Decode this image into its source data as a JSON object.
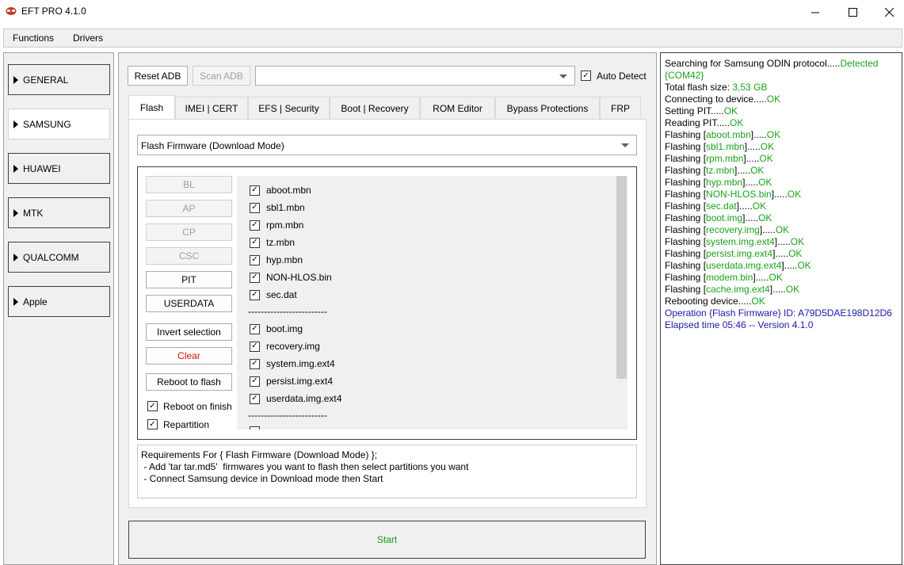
{
  "window": {
    "title": "EFT PRO 4.1.0",
    "controls": {
      "minimize": "—",
      "maximize": "☐",
      "close": "✕"
    }
  },
  "menu": {
    "items": [
      "Functions",
      "Drivers"
    ]
  },
  "categories": [
    {
      "label": "GENERAL",
      "active": false,
      "arrow": true
    },
    {
      "label": "SAMSUNG",
      "active": true,
      "arrow": true
    },
    {
      "label": "HUAWEI",
      "active": false,
      "arrow": true
    },
    {
      "label": "MTK",
      "active": false,
      "arrow": true
    },
    {
      "label": "QUALCOMM",
      "active": false,
      "arrow": true
    },
    {
      "label": "Apple",
      "active": false,
      "arrow": true
    }
  ],
  "toolbar": {
    "reset_adb": "Reset ADB",
    "scan_adb": "Scan ADB",
    "device_combo_value": "",
    "auto_detect_label": "Auto Detect",
    "auto_detect_checked": true
  },
  "tabs": [
    {
      "label": "Flash",
      "active": true
    },
    {
      "label": "IMEI | CERT",
      "active": false
    },
    {
      "label": "EFS | Security",
      "active": false
    },
    {
      "label": "Boot | Recovery",
      "active": false
    },
    {
      "label": "ROM Editor",
      "active": false
    },
    {
      "label": "Bypass Protections",
      "active": false
    },
    {
      "label": "FRP",
      "active": false
    }
  ],
  "flash": {
    "mode_select": "Flash Firmware (Download Mode)",
    "file_buttons": [
      {
        "label": "BL",
        "enabled": false
      },
      {
        "label": "AP",
        "enabled": false
      },
      {
        "label": "CP",
        "enabled": false
      },
      {
        "label": "CSC",
        "enabled": false
      },
      {
        "label": "PIT",
        "enabled": true
      },
      {
        "label": "USERDATA",
        "enabled": true
      }
    ],
    "invert_selection": "Invert selection",
    "clear": "Clear",
    "reboot_to_flash": "Reboot to flash",
    "reboot_on_finish": {
      "label": "Reboot on finish",
      "checked": true
    },
    "repartition": {
      "label": "Repartition",
      "checked": true
    },
    "separator": "-------------------------",
    "partitions_group1": [
      {
        "name": "aboot.mbn",
        "checked": true
      },
      {
        "name": "sbl1.mbn",
        "checked": true
      },
      {
        "name": "rpm.mbn",
        "checked": true
      },
      {
        "name": "tz.mbn",
        "checked": true
      },
      {
        "name": "hyp.mbn",
        "checked": true
      },
      {
        "name": "NON-HLOS.bin",
        "checked": true
      },
      {
        "name": "sec.dat",
        "checked": true
      }
    ],
    "partitions_group2": [
      {
        "name": "boot.img",
        "checked": true
      },
      {
        "name": "recovery.img",
        "checked": true
      },
      {
        "name": "system.img.ext4",
        "checked": true
      },
      {
        "name": "persist.img.ext4",
        "checked": true
      },
      {
        "name": "userdata.img.ext4",
        "checked": true
      }
    ],
    "requirements": {
      "title": "Requirements For { Flash Firmware (Download Mode) };",
      "lines": [
        " - Add 'tar tar.md5'  firmwares you want to flash then select partitions you want",
        " - Connect Samsung device in Download mode then Start"
      ]
    },
    "start": "Start"
  },
  "log": [
    [
      {
        "t": "Searching for Samsung ODIN protocol.....",
        "c": ""
      },
      {
        "t": "Detected",
        "c": "green"
      }
    ],
    [
      {
        "t": "{COM42}",
        "c": "green"
      }
    ],
    [
      {
        "t": "Total flash size: ",
        "c": ""
      },
      {
        "t": "3,53 GB",
        "c": "green"
      }
    ],
    [
      {
        "t": "Connecting to device.....",
        "c": ""
      },
      {
        "t": "OK",
        "c": "green"
      }
    ],
    [
      {
        "t": "Setting PIT.....",
        "c": ""
      },
      {
        "t": "OK",
        "c": "green"
      }
    ],
    [
      {
        "t": "Reading PIT.....",
        "c": ""
      },
      {
        "t": "OK",
        "c": "green"
      }
    ],
    [
      {
        "t": "Flashing [",
        "c": ""
      },
      {
        "t": "aboot.mbn",
        "c": "green"
      },
      {
        "t": "].....",
        "c": ""
      },
      {
        "t": "OK",
        "c": "green"
      }
    ],
    [
      {
        "t": "Flashing [",
        "c": ""
      },
      {
        "t": "sbl1.mbn",
        "c": "green"
      },
      {
        "t": "].....",
        "c": ""
      },
      {
        "t": "OK",
        "c": "green"
      }
    ],
    [
      {
        "t": "Flashing [",
        "c": ""
      },
      {
        "t": "rpm.mbn",
        "c": "green"
      },
      {
        "t": "].....",
        "c": ""
      },
      {
        "t": "OK",
        "c": "green"
      }
    ],
    [
      {
        "t": "Flashing [",
        "c": ""
      },
      {
        "t": "tz.mbn",
        "c": "green"
      },
      {
        "t": "].....",
        "c": ""
      },
      {
        "t": "OK",
        "c": "green"
      }
    ],
    [
      {
        "t": "Flashing [",
        "c": ""
      },
      {
        "t": "hyp.mbn",
        "c": "green"
      },
      {
        "t": "].....",
        "c": ""
      },
      {
        "t": "OK",
        "c": "green"
      }
    ],
    [
      {
        "t": "Flashing [",
        "c": ""
      },
      {
        "t": "NON-HLOS.bin",
        "c": "green"
      },
      {
        "t": "].....",
        "c": ""
      },
      {
        "t": "OK",
        "c": "green"
      }
    ],
    [
      {
        "t": "Flashing [",
        "c": ""
      },
      {
        "t": "sec.dat",
        "c": "green"
      },
      {
        "t": "].....",
        "c": ""
      },
      {
        "t": "OK",
        "c": "green"
      }
    ],
    [
      {
        "t": "Flashing [",
        "c": ""
      },
      {
        "t": "boot.img",
        "c": "green"
      },
      {
        "t": "].....",
        "c": ""
      },
      {
        "t": "OK",
        "c": "green"
      }
    ],
    [
      {
        "t": "Flashing [",
        "c": ""
      },
      {
        "t": "recovery.img",
        "c": "green"
      },
      {
        "t": "].....",
        "c": ""
      },
      {
        "t": "OK",
        "c": "green"
      }
    ],
    [
      {
        "t": "Flashing [",
        "c": ""
      },
      {
        "t": "system.img.ext4",
        "c": "green"
      },
      {
        "t": "].....",
        "c": ""
      },
      {
        "t": "OK",
        "c": "green"
      }
    ],
    [
      {
        "t": "Flashing [",
        "c": ""
      },
      {
        "t": "persist.img.ext4",
        "c": "green"
      },
      {
        "t": "].....",
        "c": ""
      },
      {
        "t": "OK",
        "c": "green"
      }
    ],
    [
      {
        "t": "Flashing [",
        "c": ""
      },
      {
        "t": "userdata.img.ext4",
        "c": "green"
      },
      {
        "t": "].....",
        "c": ""
      },
      {
        "t": "OK",
        "c": "green"
      }
    ],
    [
      {
        "t": "Flashing [",
        "c": ""
      },
      {
        "t": "modem.bin",
        "c": "green"
      },
      {
        "t": "].....",
        "c": ""
      },
      {
        "t": "OK",
        "c": "green"
      }
    ],
    [
      {
        "t": "Flashing [",
        "c": ""
      },
      {
        "t": "cache.img.ext4",
        "c": "green"
      },
      {
        "t": "].....",
        "c": ""
      },
      {
        "t": "OK",
        "c": "green"
      }
    ],
    [
      {
        "t": "Rebooting device.....",
        "c": ""
      },
      {
        "t": "OK",
        "c": "green"
      }
    ],
    [
      {
        "t": "Operation {Flash Firmware} ID: A79D5DAE198D12D6",
        "c": "blue"
      }
    ],
    [
      {
        "t": "Elapsed time 05:46 -- Version 4.1.0",
        "c": "blue"
      }
    ]
  ],
  "colors": {
    "ok_green": "#1aa31a",
    "info_blue": "#1a1aa8",
    "clear_red": "#d01010",
    "start_green": "#109a10"
  }
}
